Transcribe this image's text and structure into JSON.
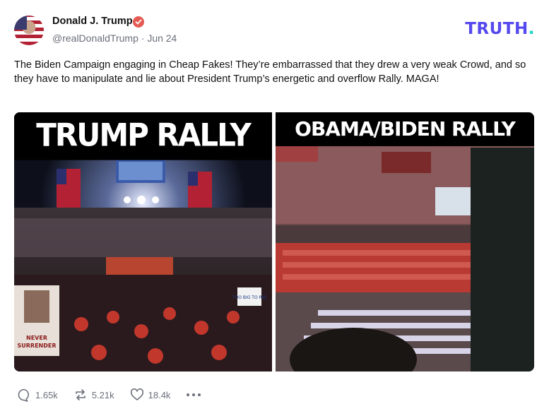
{
  "author": {
    "name": "Donald J. Trump",
    "handle": "@realDonaldTrump",
    "separator": "·",
    "date": "Jun 24"
  },
  "brand": {
    "name": "TRUTH",
    "dot": ".",
    "color": "#5448ee",
    "dot_color": "#19d3c5"
  },
  "post": {
    "text": "The Biden Campaign engaging in Cheap Fakes! They’re embarrassed that they drew a very weak Crowd, and so they have to manipulate and lie about President Trump’s energetic and overflow Rally. MAGA!"
  },
  "media": {
    "left_caption": "TRUMP RALLY",
    "right_caption": "OBAMA/BIDEN RALLY",
    "sign_text_top": "NEVER",
    "sign_text_bottom": "SURRENDER",
    "sign_small": "TOO BIG TO RIG"
  },
  "actions": {
    "replies": "1.65k",
    "retruths": "5.21k",
    "likes": "18.4k",
    "more_icon": "more-dots-icon"
  },
  "colors": {
    "verified": "#e35b53",
    "muted_text": "#6b6f7a"
  }
}
